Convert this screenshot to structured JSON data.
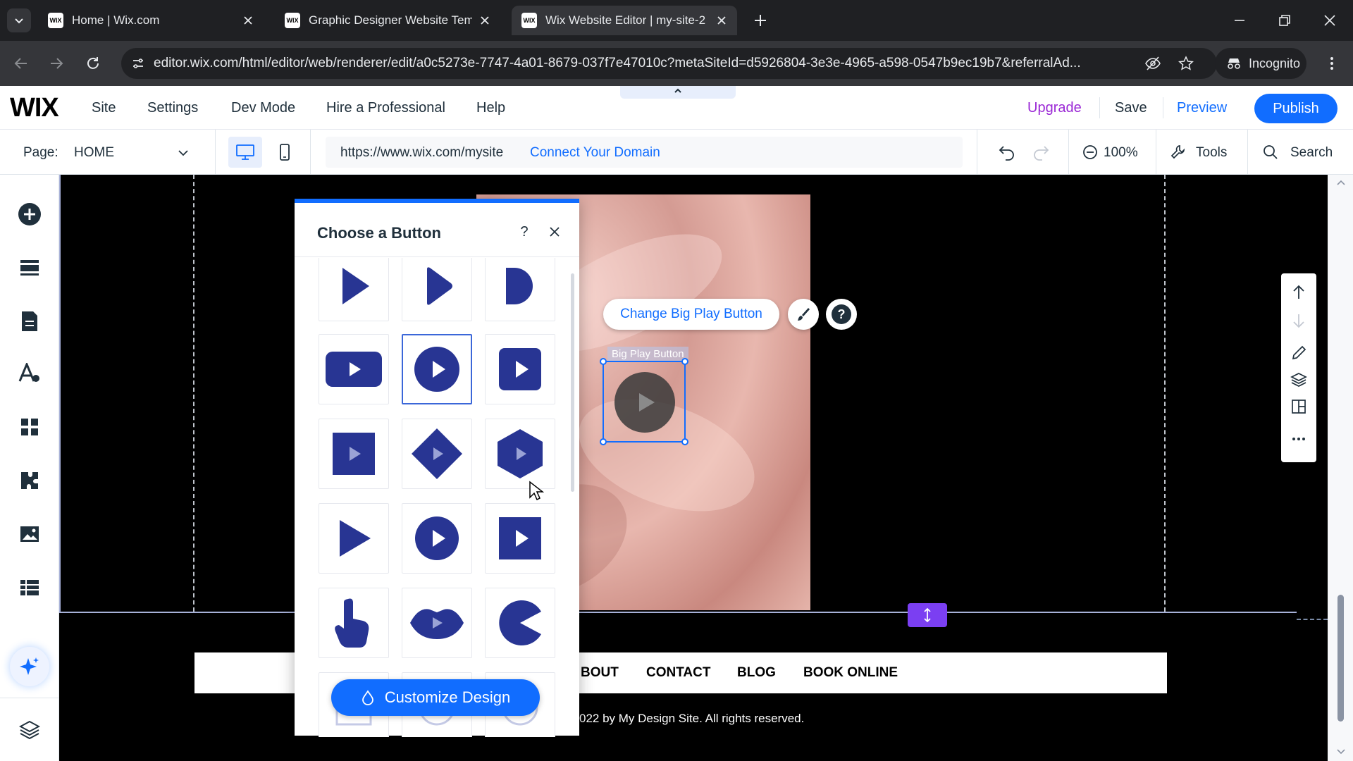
{
  "browser": {
    "tabs": [
      {
        "title": "Home | Wix.com",
        "favicon": "WIX"
      },
      {
        "title": "Graphic Designer Website Temp",
        "favicon": "WIX"
      },
      {
        "title": "Wix Website Editor | my-site-2",
        "favicon": "WIX"
      }
    ],
    "url": "editor.wix.com/html/editor/web/renderer/edit/a0c5273e-7747-4a01-8679-037f7e47010c?metaSiteId=d5926804-3e3e-4965-a598-0547b9ec19b7&referralAd...",
    "incognito_label": "Incognito"
  },
  "editor": {
    "logo": "WIX",
    "menu": [
      "Site",
      "Settings",
      "Dev Mode",
      "Hire a Professional",
      "Help"
    ],
    "upgrade": "Upgrade",
    "save": "Save",
    "preview": "Preview",
    "publish": "Publish",
    "page_label": "Page:",
    "page_value": "HOME",
    "site_url": "https://www.wix.com/mysite",
    "connect_domain": "Connect Your Domain",
    "zoom": "100%",
    "tools": "Tools",
    "search": "Search"
  },
  "panel": {
    "title": "Choose a Button",
    "customize": "Customize Design"
  },
  "canvas": {
    "change_button": "Change Big Play Button",
    "element_label": "Big Play Button",
    "nav": [
      "BOUT",
      "CONTACT",
      "BLOG",
      "BOOK ONLINE"
    ],
    "footer": "022 by My Design Site. All rights reserved."
  },
  "colors": {
    "accent": "#116dff",
    "upgrade": "#9a27d5",
    "button_navy": "#283593",
    "stretch_handle": "#7b3ff2"
  }
}
